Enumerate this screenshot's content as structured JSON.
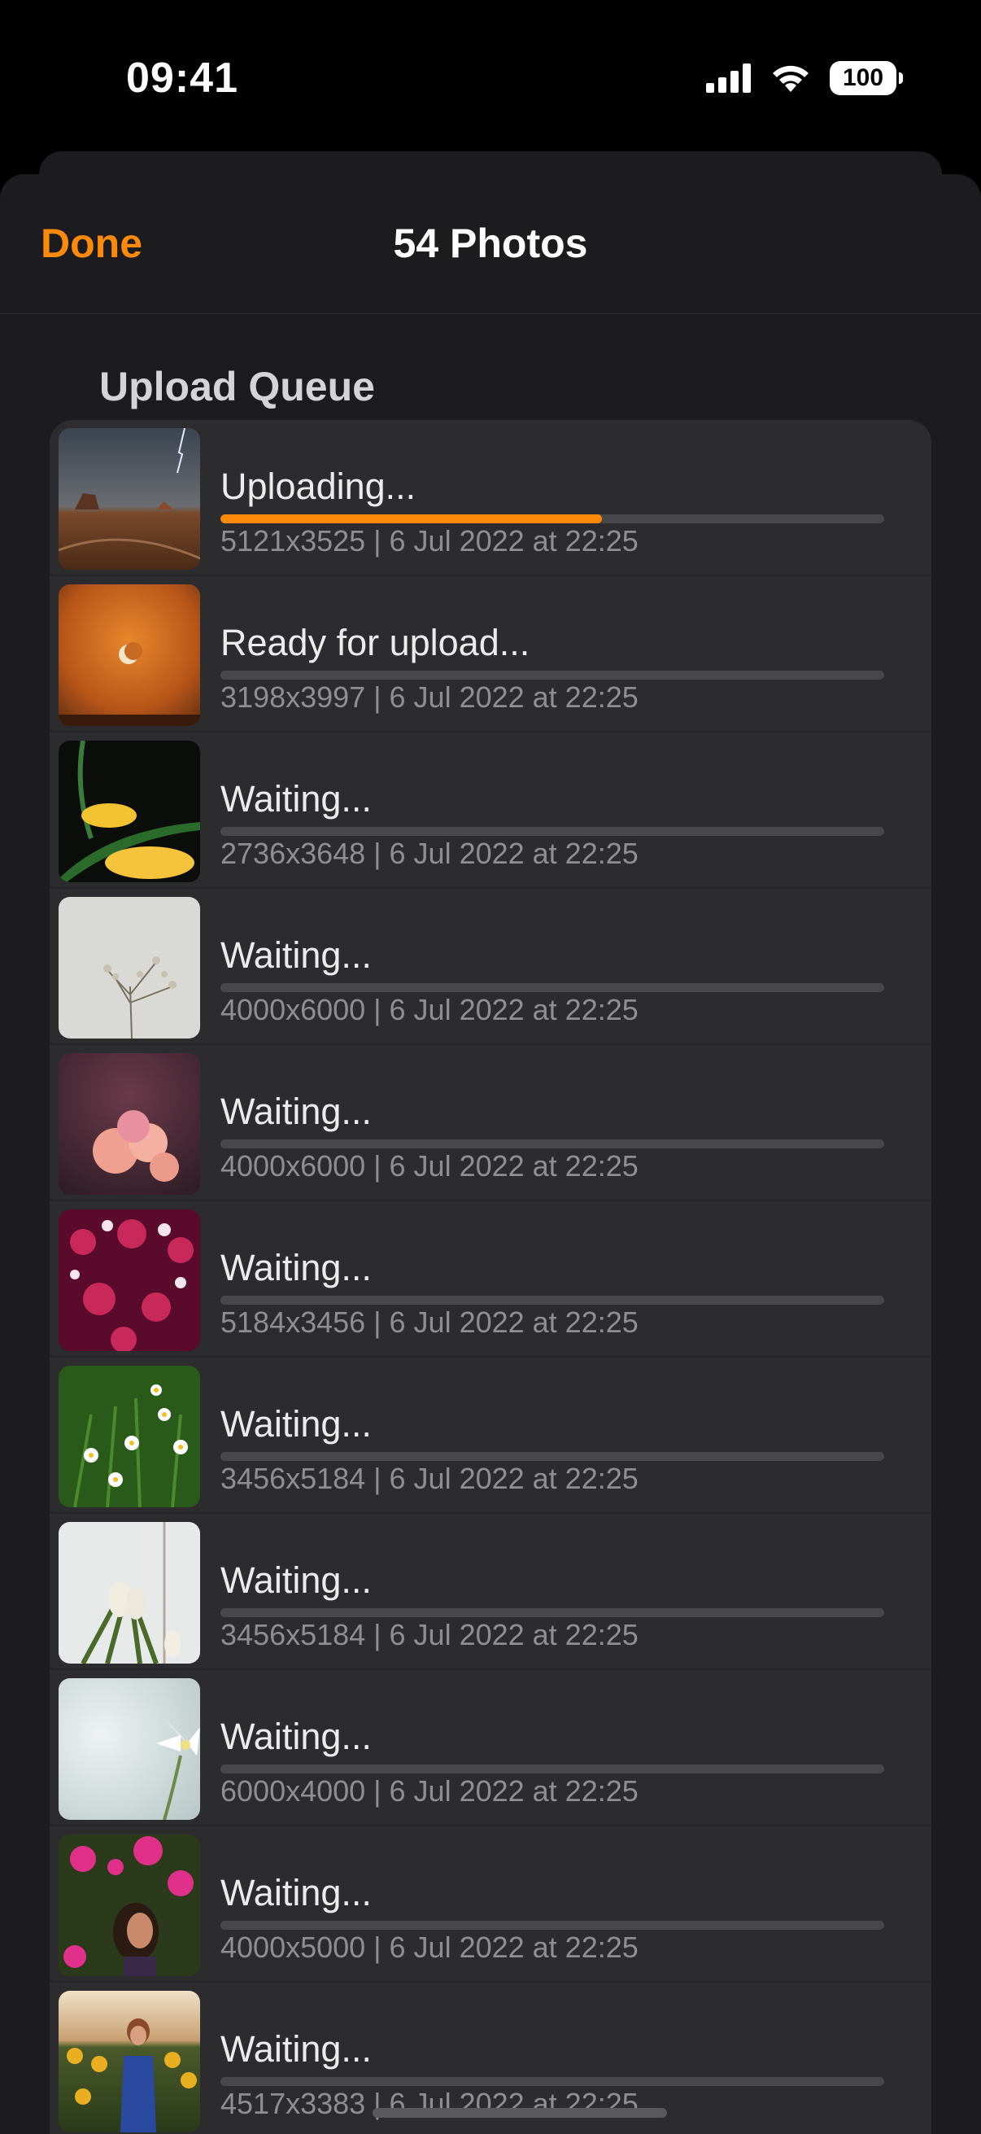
{
  "status_bar": {
    "time": "09:41",
    "battery": "100"
  },
  "nav": {
    "done_label": "Done",
    "title": "54 Photos"
  },
  "section": {
    "title": "Upload Queue"
  },
  "queue": [
    {
      "status": "Uploading...",
      "meta": "5121x3525 | 6 Jul 2022 at 22:25",
      "progress": 0.575,
      "thumb": "desert-storm"
    },
    {
      "status": "Ready for upload...",
      "meta": "3198x3997 | 6 Jul 2022 at 22:25",
      "progress": 0,
      "thumb": "orange-moon-sky"
    },
    {
      "status": "Waiting...",
      "meta": "2736x3648 | 6 Jul 2022 at 22:25",
      "progress": 0,
      "thumb": "yellow-tulip"
    },
    {
      "status": "Waiting...",
      "meta": "4000x6000 | 6 Jul 2022 at 22:25",
      "progress": 0,
      "thumb": "dry-flowers"
    },
    {
      "status": "Waiting...",
      "meta": "4000x6000 | 6 Jul 2022 at 22:25",
      "progress": 0,
      "thumb": "rose-bouquet"
    },
    {
      "status": "Waiting...",
      "meta": "5184x3456 | 6 Jul 2022 at 22:25",
      "progress": 0,
      "thumb": "pink-blossoms"
    },
    {
      "status": "Waiting...",
      "meta": "3456x5184 | 6 Jul 2022 at 22:25",
      "progress": 0,
      "thumb": "daisies"
    },
    {
      "status": "Waiting...",
      "meta": "3456x5184 | 6 Jul 2022 at 22:25",
      "progress": 0,
      "thumb": "white-tulips"
    },
    {
      "status": "Waiting...",
      "meta": "6000x4000 | 6 Jul 2022 at 22:25",
      "progress": 0,
      "thumb": "white-flower"
    },
    {
      "status": "Waiting...",
      "meta": "4000x5000 | 6 Jul 2022 at 22:25",
      "progress": 0,
      "thumb": "bougainvillea-portrait"
    },
    {
      "status": "Waiting...",
      "meta": "4517x3383 | 6 Jul 2022 at 22:25",
      "progress": 0,
      "thumb": "sunflower-field-portrait"
    }
  ],
  "colors": {
    "accent": "#ff8a0a",
    "background": "#1c1c1e",
    "row_background": "#2c2c2e",
    "secondary_text": "#8e8e93"
  }
}
